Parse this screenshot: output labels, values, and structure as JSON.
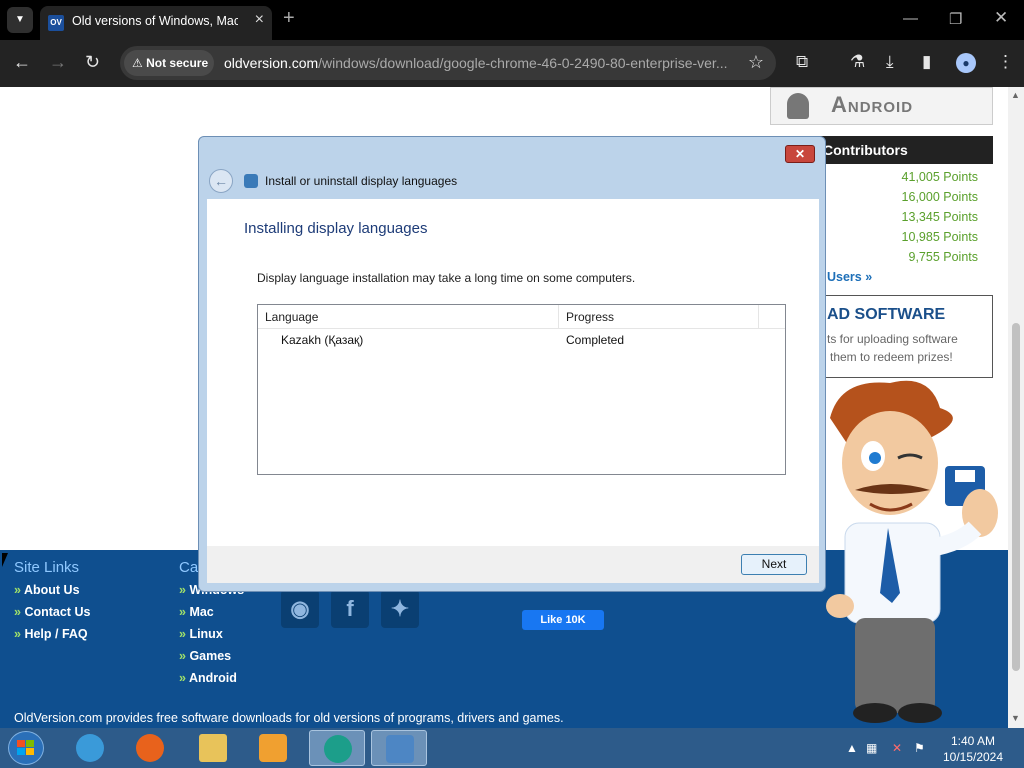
{
  "browser": {
    "tab_list_icon": "chevron-down-icon",
    "tab": {
      "favicon_text": "OV",
      "title": "Old versions of Windows, Mac"
    },
    "security_label": "Not secure",
    "url_host": "oldversion.com",
    "url_path": "/windows/download/google-chrome-46-0-2490-80-enterprise-ver..."
  },
  "page": {
    "android_label": "Android",
    "contributors_heading": "Contributors",
    "points": [
      "41,005 Points",
      "16,000 Points",
      "13,345 Points",
      "10,985 Points",
      "9,755 Points"
    ],
    "all_users_link": "Users »",
    "upload_title": "AD SOFTWARE",
    "upload_text_1": "ts for uploading software",
    "upload_text_2": "them to redeem prizes!",
    "footer": {
      "site_links_heading": "Site Links",
      "site_links": [
        "About Us",
        "Contact Us",
        "Help / FAQ"
      ],
      "categories_heading": "Ca",
      "categories": [
        "Windows",
        "Mac",
        "Linux",
        "Games",
        "Android"
      ],
      "like_button": "Like 10K",
      "note": "OldVersion.com provides free software downloads for old versions of programs, drivers and games."
    }
  },
  "dialog": {
    "title": "Install or uninstall display languages",
    "heading": "Installing display languages",
    "description": "Display language installation may take a long time on some computers.",
    "columns": [
      "Language",
      "Progress"
    ],
    "rows": [
      {
        "language": "Kazakh (Қазақ)",
        "progress": "Completed"
      }
    ],
    "next_label": "Next",
    "close_label": "✕"
  },
  "taskbar": {
    "time": "1:40 AM",
    "date": "10/15/2024"
  },
  "colors": {
    "footer_bg": "#0f4f8f",
    "points_green": "#5aa02c",
    "taskbar": "#2d5b8a",
    "dialog_frame": "#bcd3ea"
  }
}
